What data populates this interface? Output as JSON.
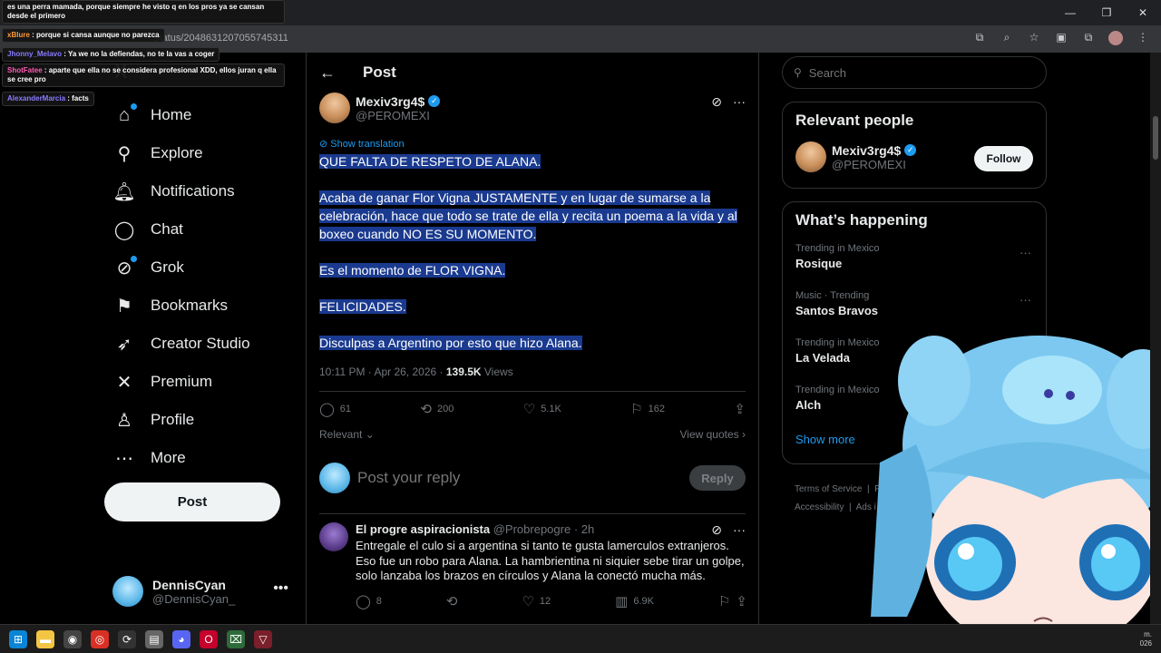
{
  "browser": {
    "url": "status/2048631207055745311"
  },
  "chat": [
    {
      "user": "",
      "text": "es una perra mamada, porque siempre he visto q en los pros ya se cansan desde el primero",
      "color": "#ffffff"
    },
    {
      "user": "xBlure",
      "text": "porque si cansa aunque no parezca",
      "color": "#ffffff"
    },
    {
      "user": "Jhonny_Melavo",
      "text": "Ya we no la defiendas, no te la vas a coger",
      "color": "#8a7cff"
    },
    {
      "user": "ShotFatee",
      "text": "aparte que ella no se considera profesional XDD, ellos juran q ella se cree pro",
      "color": "#ff5ab4"
    },
    {
      "user": "AlexanderMarcia",
      "text": "facts",
      "color": "#8a7cff"
    }
  ],
  "nav": {
    "items": [
      {
        "label": "Home",
        "icon": "home-icon"
      },
      {
        "label": "Explore",
        "icon": "search-icon"
      },
      {
        "label": "Notifications",
        "icon": "bell-icon"
      },
      {
        "label": "Chat",
        "icon": "chat-icon"
      },
      {
        "label": "Grok",
        "icon": "grok-icon"
      },
      {
        "label": "Bookmarks",
        "icon": "bookmark-icon"
      },
      {
        "label": "Creator Studio",
        "icon": "rocket-icon"
      },
      {
        "label": "Premium",
        "icon": "x-icon"
      },
      {
        "label": "Profile",
        "icon": "person-icon"
      },
      {
        "label": "More",
        "icon": "more-icon"
      }
    ],
    "post_button": "Post"
  },
  "account": {
    "name": "DennisCyan",
    "handle": "@DennisCyan_"
  },
  "main": {
    "title": "Post",
    "author": {
      "name": "Mexiv3rg4$",
      "handle": "@PEROMEXI"
    },
    "show_translation": "Show translation",
    "paragraphs": [
      "QUE FALTA DE RESPETO DE ALANA.",
      "Acaba de ganar Flor Vigna JUSTAMENTE y en lugar de sumarse a la celebración, hace que todo se trate de ella y recita un poema a la vida y al boxeo cuando NO ES SU MOMENTO.",
      "Es el momento de FLOR VIGNA.",
      "FELICIDADES.",
      "Disculpas a Argentino por esto que hizo Alana."
    ],
    "timestamp": "10:11 PM · Apr 26, 2026 · ",
    "views_count": "139.5K",
    "views_label": " Views",
    "stats": {
      "replies": "61",
      "reposts": "200",
      "likes": "5.1K",
      "bookmarks": "162"
    },
    "sort_label": "Relevant",
    "view_quotes": "View quotes",
    "reply_placeholder": "Post your reply",
    "reply_button": "Reply",
    "comment": {
      "name": "El progre aspiracionista",
      "handle": "@Probrepogre",
      "time": "· 2h",
      "text": "Entregale el culo si a argentina si tanto te gusta lamerculos extranjeros. Eso fue un robo para Alana. La hambrientina ni siquier sebe tirar un golpe, solo lanzaba los brazos en círculos y Alana la conectó mucha más.",
      "replies": "8",
      "reposts": "",
      "likes": "12",
      "views": "6.9K"
    }
  },
  "sidebar": {
    "search_placeholder": "Search",
    "relevant_title": "Relevant people",
    "person": {
      "name": "Mexiv3rg4$",
      "handle": "@PEROMEXI",
      "follow": "Follow"
    },
    "happening_title": "What’s happening",
    "trends": [
      {
        "context": "Trending in Mexico",
        "name": "Rosique"
      },
      {
        "context": "Music · Trending",
        "name": "Santos Bravos"
      },
      {
        "context": "Trending in Mexico",
        "name": "La Velada"
      },
      {
        "context": "Trending in Mexico",
        "name": "Alch"
      }
    ],
    "show_more": "Show more",
    "footer": {
      "terms": "Terms of Service",
      "privacy": "Pri",
      "accessibility": "Accessibility",
      "ads": "Ads i"
    }
  },
  "taskbar": {
    "clock_line1": "m.",
    "clock_line2": "026"
  },
  "colors": {
    "accent": "#1d9bf0",
    "background": "#000000",
    "highlight": "#1a3a8f"
  }
}
